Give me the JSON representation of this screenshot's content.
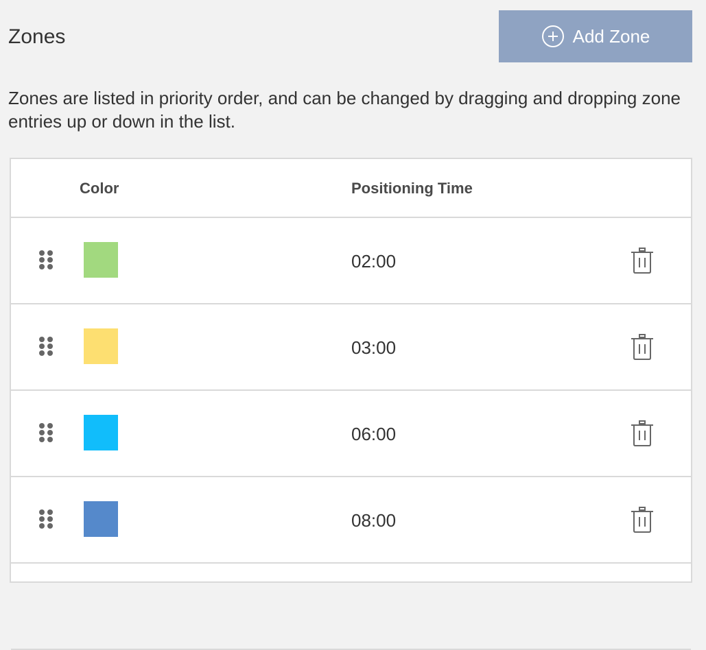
{
  "header": {
    "title": "Zones",
    "add_button_label": "Add Zone",
    "add_button_icon": "plus-circle-icon"
  },
  "description": "Zones are listed in priority order, and can be changed by dragging and dropping zone entries up or down in the list.",
  "table": {
    "columns": [
      "Color",
      "Positioning Time"
    ],
    "rows": [
      {
        "color": "#a2d97f",
        "time": "02:00"
      },
      {
        "color": "#fddf71",
        "time": "03:00"
      },
      {
        "color": "#11bdfb",
        "time": "06:00"
      },
      {
        "color": "#5589cb",
        "time": "08:00"
      },
      {
        "color": "",
        "time": ""
      }
    ]
  },
  "colors": {
    "background": "#f2f2f2",
    "button": "#8fa3c2",
    "border": "#d9d9d9",
    "icon": "#666666"
  }
}
